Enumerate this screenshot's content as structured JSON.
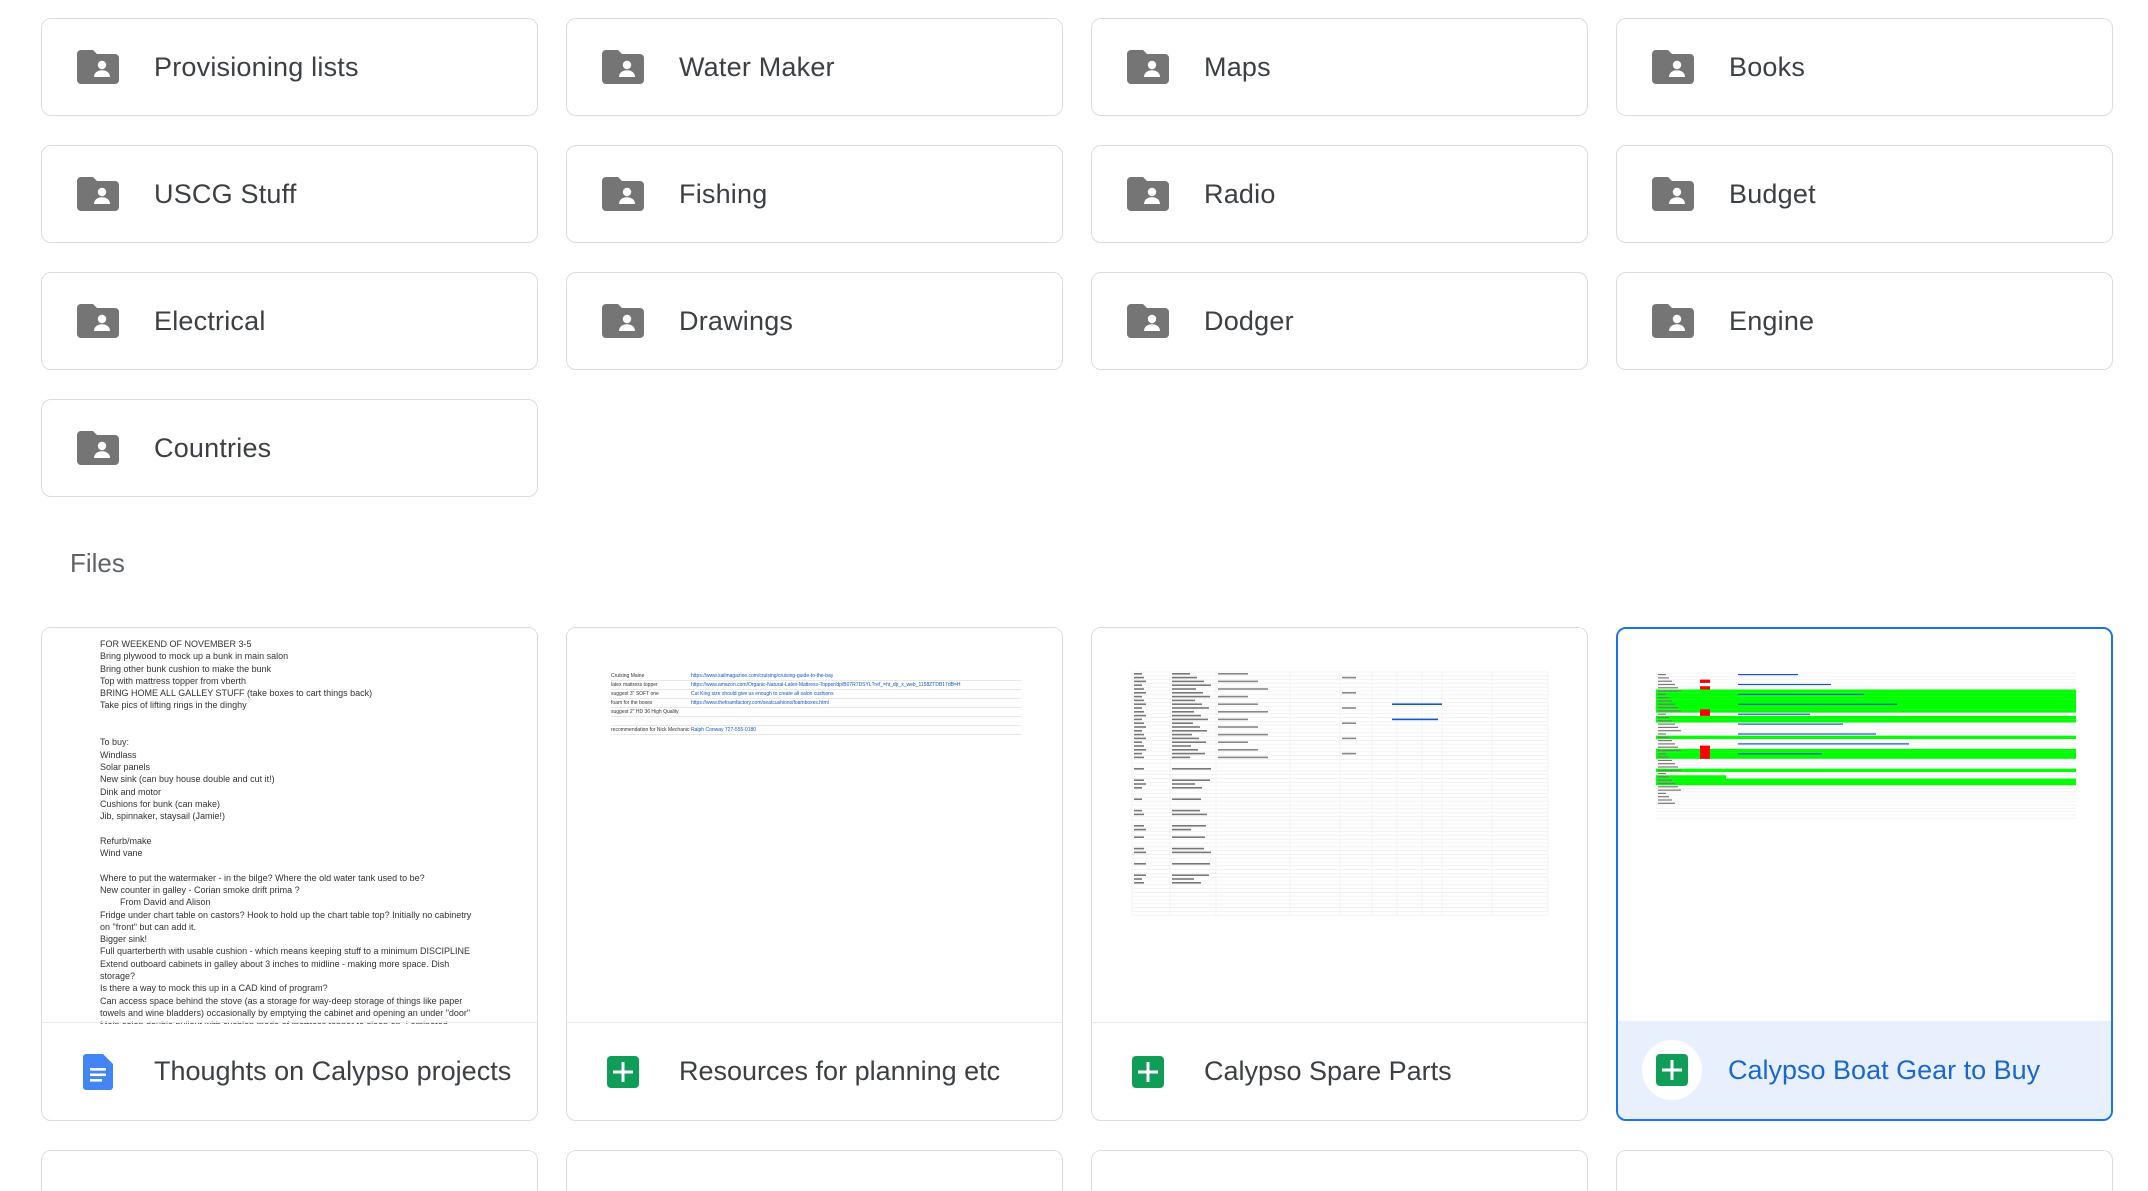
{
  "folders": [
    {
      "label": "Provisioning lists"
    },
    {
      "label": "Water Maker"
    },
    {
      "label": "Maps"
    },
    {
      "label": "Books"
    },
    {
      "label": "USCG Stuff"
    },
    {
      "label": "Fishing"
    },
    {
      "label": "Radio"
    },
    {
      "label": "Budget"
    },
    {
      "label": "Electrical"
    },
    {
      "label": "Drawings"
    },
    {
      "label": "Dodger"
    },
    {
      "label": "Engine"
    },
    {
      "label": "Countries"
    }
  ],
  "files_heading": "Files",
  "files": [
    {
      "label": "Thoughts on Calypso projects",
      "type": "doc-icon",
      "color": "#4285f4"
    },
    {
      "label": "Resources for planning etc",
      "type": "sheets-icon",
      "color": "#0f9d58"
    },
    {
      "label": "Calypso Spare Parts",
      "type": "sheets-icon",
      "color": "#0f9d58"
    },
    {
      "label": "Calypso Boat Gear to Buy",
      "type": "sheets-icon",
      "color": "#0f9d58",
      "selected": true
    }
  ],
  "doc_preview": [
    "FOR WEEKEND OF NOVEMBER 3-5",
    "Bring plywood to mock up a bunk in main salon",
    "Bring other bunk cushion to make the bunk",
    "Top with mattress topper from vberth",
    "BRING HOME ALL GALLEY STUFF (take boxes to cart things back)",
    "Take pics of lifting rings in the dinghy",
    "",
    "",
    "To buy:",
    "Windlass",
    "Solar panels",
    "New sink (can buy house double and cut it!)",
    "Dink and motor",
    "Cushions for bunk (can make)",
    "Jib, spinnaker, staysail (Jamie!)",
    "",
    "Refurb/make",
    "Wind vane",
    "",
    "Where to put the watermaker - in the bilge? Where the old water tank used to be?",
    "New counter in galley - Corian smoke drift prima ?",
    "        From David and Alison",
    "Fridge under chart table on castors? Hook to hold up the chart table top? Initially no cabinetry",
    "on \"front\" but can add it.",
    "Bigger sink!",
    "Full quarterberth with usable cushion - which means keeping stuff to a minimum DISCIPLINE",
    "Extend outboard cabinets in galley about 3 inches to midline - making more space. Dish",
    "storage?",
    "Is there a way to mock this up in a CAD kind of program?",
    "Can access space behind the stove (as a storage for way-deep storage of things like paper",
    "towels and wine bladders) occasionally by emptying the cabinet and opening an under \"door\"",
    "Main salon double pullout with cushion made of mattress topper to sleep on. Laminated"
  ],
  "resources_preview": [
    {
      "a": "Cruising Maine",
      "b": "https://www.sailmagazine.com/cruising/cruising-guide-to-the-bay"
    },
    {
      "a": "latex mattress topper",
      "b": "https://www.amazon.com/Organic-Natural-Latex-Mattress-Topper/dp/B07R7DSYL?ref_=ht_dp_x_web_1158ZTDB17dB=H"
    },
    {
      "a": "        suggest 3\" SOFT one",
      "b": "Cut King size should give us enough to create all salon cushions"
    },
    {
      "a": "foam for the boxes",
      "b": "https://www.thefoamfactory.com/seatcushions/foamboxes.html"
    },
    {
      "a": "        suggest 2\" HD 36 High Quality",
      "b": ""
    },
    {
      "a": "",
      "b": ""
    },
    {
      "a": "recommendation for Nick Mechanic worker guy",
      "b": "Ralph Conway 727-555-0180"
    }
  ],
  "colors": {
    "accent": "#1a73e8",
    "folder_icon": "#757575",
    "sheet_green": "#0f9d58",
    "doc_blue": "#4285f4",
    "highlight_green": "#00ff00",
    "highlight_red": "#ff0000"
  }
}
